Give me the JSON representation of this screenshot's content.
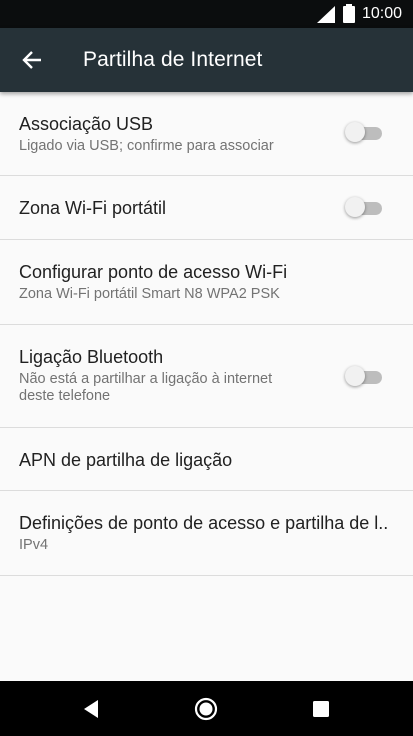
{
  "status_bar": {
    "time": "10:00",
    "icons": [
      "signal-icon",
      "battery-icon"
    ]
  },
  "app_bar": {
    "back_icon": "arrow-left-icon",
    "title": "Partilha de Internet",
    "background": "#263238"
  },
  "items": [
    {
      "title": "Associação USB",
      "subtitle": "Ligado via USB; confirme para associar",
      "toggle": false
    },
    {
      "title": "Zona Wi-Fi portátil",
      "toggle": false
    },
    {
      "title": "Configurar ponto de acesso Wi-Fi",
      "subtitle": "Zona Wi-Fi portátil Smart N8 WPA2 PSK"
    },
    {
      "title": "Ligação Bluetooth",
      "subtitle_lines": [
        "Não está a partilhar a ligação à internet",
        "deste telefone"
      ],
      "toggle": false
    },
    {
      "title": "APN de partilha de ligação"
    },
    {
      "title": "Definições de ponto de acesso e partilha de l..",
      "subtitle": "IPv4"
    }
  ],
  "nav_bar": {
    "icons": [
      "nav-back-icon",
      "nav-home-icon",
      "nav-recents-icon"
    ]
  }
}
